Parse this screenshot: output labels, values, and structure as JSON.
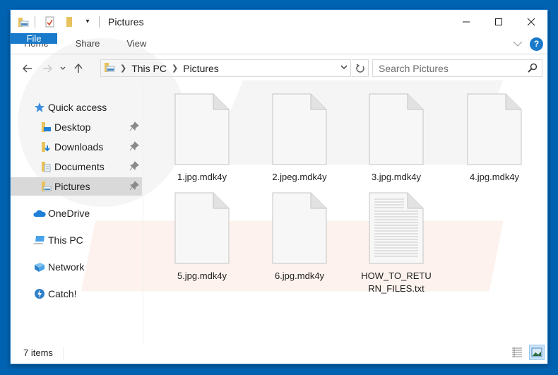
{
  "window": {
    "title": "Pictures",
    "controls": {
      "minimize": "minimize",
      "maximize": "maximize",
      "close": "close"
    }
  },
  "ribbon": {
    "tabs": [
      {
        "label": "File"
      },
      {
        "label": "Home"
      },
      {
        "label": "Share"
      },
      {
        "label": "View"
      }
    ],
    "help_label": "?"
  },
  "navigation": {
    "breadcrumbs": [
      "This PC",
      "Pictures"
    ],
    "search_placeholder": "Search Pictures"
  },
  "sidebar": {
    "items": [
      {
        "label": "Quick access",
        "icon": "star-icon"
      },
      {
        "label": "Desktop",
        "icon": "desktop-folder-icon",
        "pinned": true
      },
      {
        "label": "Downloads",
        "icon": "downloads-folder-icon",
        "pinned": true
      },
      {
        "label": "Documents",
        "icon": "documents-folder-icon",
        "pinned": true
      },
      {
        "label": "Pictures",
        "icon": "pictures-folder-icon",
        "pinned": true,
        "selected": true
      },
      {
        "label": "OneDrive",
        "icon": "onedrive-icon"
      },
      {
        "label": "This PC",
        "icon": "computer-icon"
      },
      {
        "label": "Network",
        "icon": "network-icon"
      },
      {
        "label": "Catch!",
        "icon": "catch-icon"
      }
    ]
  },
  "files": [
    {
      "name": "1.jpg.mdk4y",
      "type": "blank"
    },
    {
      "name": "2.jpeg.mdk4y",
      "type": "blank"
    },
    {
      "name": "3.jpg.mdk4y",
      "type": "blank"
    },
    {
      "name": "4.jpg.mdk4y",
      "type": "blank"
    },
    {
      "name": "5.jpg.mdk4y",
      "type": "blank"
    },
    {
      "name": "6.jpg.mdk4y",
      "type": "blank"
    },
    {
      "name": "HOW_TO_RETURN_FILES.txt",
      "type": "text"
    }
  ],
  "status": {
    "item_count": "7 items"
  },
  "colors": {
    "accent": "#1979ca",
    "desktop": "#0063b1",
    "selected": "#d9d9d9"
  }
}
